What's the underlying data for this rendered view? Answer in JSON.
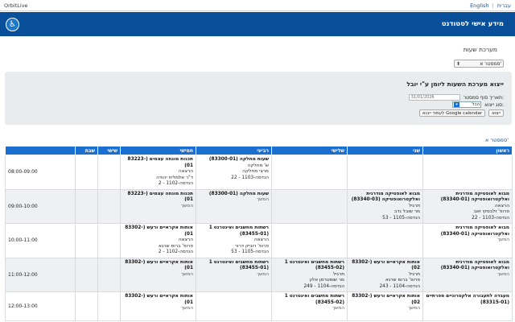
{
  "topbar": {
    "brand": "OrbitLive",
    "languages": [
      "English",
      "עברית"
    ]
  },
  "header": {
    "title": "מידע אישי לסטודנט"
  },
  "section_title": "מערכת שעות",
  "semester_select": {
    "value": "סמסטר א'"
  },
  "export_panel": {
    "title": "ייצוא מערכת השעות ליומן ע\"י יובל",
    "end_date_label": "תאריך סוף סמסטר:",
    "end_date_value": "31/01/2026",
    "export_type_label": "סוג ייצוא:",
    "export_type_value": "הכל",
    "export_button": "ייצוא",
    "google_button": "לעמוד ייבוא Google calendar"
  },
  "semester_label": "סמסטר א'",
  "table": {
    "headers": [
      "ראשון",
      "שני",
      "שלישי",
      "רביעי",
      "חמישי",
      "שישי",
      "שבת"
    ],
    "rows": [
      {
        "hour": "08:00-09:00",
        "cells": [
          [],
          [],
          [],
          [
            "שעות מחלקה (83300-01)",
            "ש' מחלקה",
            "מרצי מחלקה",
            "הנדסה-1103 - 22"
          ],
          [
            "תכנות מונחה עצמים (83223-01)",
            "הרצאה",
            "ד\"ר אלמליח יהודה",
            "הנדסה-1102 - 2"
          ],
          [],
          []
        ]
      },
      {
        "hour": "09:00-10:00",
        "cells": [
          [
            "מבוא לאופטיקה מודרנית ואלקטרואופטיקה (83340-01)",
            "הרצאה",
            "פרופ' זלבסקי זאב",
            "הנדסה-1103 - 22"
          ],
          [
            "מבוא לאופטיקה מודרנית ואלקטרואופטיקה (83340-03)",
            "תרגיל",
            "מר שובל נדב",
            "הנדסה-1105 - 53"
          ],
          [],
          [
            "שעות מחלקה (83300-01)",
            "המשך"
          ],
          [
            "תכנות מונחה עצמים (83223-01)",
            "המשך"
          ],
          [],
          []
        ]
      },
      {
        "hour": "10:00-11:00",
        "cells": [
          [
            "מבוא לאופטיקה מודרנית ואלקטרואופטיקה (83340-01)",
            "המשך"
          ],
          [],
          [],
          [
            "רשתות מחשבים ואינטרנט 1 (83455-01)",
            "הרצאה",
            "פרופ' רוביק דרור",
            "הנדסה-1105 - 53"
          ],
          [
            "אותות אקראיים ורעש (83302-01)",
            "הרצאה",
            "פרופ' ברוס שרגא",
            "הנדסה-1102 - 2"
          ],
          [],
          []
        ]
      },
      {
        "hour": "11:00-12:00",
        "cells": [
          [
            "מבוא לאופטיקה מודרנית ואלקטרואופטיקה (83340-01)",
            "המשך"
          ],
          [
            "אותות אקראיים ורעש (83302-02)",
            "תרגיל",
            "פרופ' ברוס שרגא",
            "הנדסה-1104 - 243"
          ],
          [
            "רשתות מחשבים ואינטרנט 1 (83455-02)",
            "תרגיל",
            "מר שוסטרמן אלון",
            "הנדסה-1104 - 249"
          ],
          [
            "רשתות מחשבים ואינטרנט 1 (83455-01)",
            "המשך"
          ],
          [
            "אותות אקראיים ורעש (83302-01)",
            "המשך"
          ],
          [],
          []
        ]
      },
      {
        "hour": "12:00-13:00",
        "cells": [
          [
            "מעבדה לתעבורה אלקטרוניים ספרתיים (83315-01)"
          ],
          [
            "אותות אקראיים ורעש (83302-02)",
            "המשך"
          ],
          [
            "רשתות מחשבים ואינטרנט 1 (83455-02)",
            "המשך"
          ],
          [],
          [
            "אותות אקראיים ורעש (83302-01)",
            "המשך"
          ],
          [],
          []
        ]
      }
    ]
  }
}
